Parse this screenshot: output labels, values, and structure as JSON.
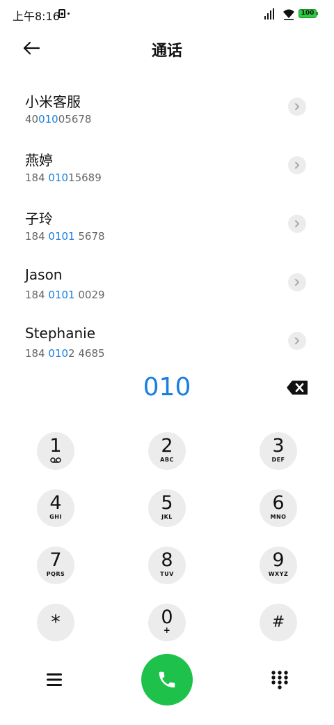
{
  "status_bar": {
    "time": "上午8:16",
    "battery": "100"
  },
  "header": {
    "title": "通话"
  },
  "contacts": [
    {
      "name": "小米客服",
      "number_prefix": "40",
      "number_match": "010",
      "number_suffix": "05678"
    },
    {
      "name": "燕婷",
      "number_prefix": "184 ",
      "number_match": "010",
      "number_suffix": "15689"
    },
    {
      "name": "子玲",
      "number_prefix": "184 ",
      "number_match": "0101",
      "number_suffix": " 5678"
    },
    {
      "name": "Jason",
      "number_prefix": "184 ",
      "number_match": "0101",
      "number_suffix": " 0029"
    },
    {
      "name": "Stephanie",
      "number_prefix": "184 ",
      "number_match": "010",
      "number_suffix": "2 4685"
    }
  ],
  "dialer": {
    "dialed": "010"
  },
  "keypad": {
    "keys": [
      {
        "digit": "1",
        "letters": ""
      },
      {
        "digit": "2",
        "letters": "ABC"
      },
      {
        "digit": "3",
        "letters": "DEF"
      },
      {
        "digit": "4",
        "letters": "GHI"
      },
      {
        "digit": "5",
        "letters": "JKL"
      },
      {
        "digit": "6",
        "letters": "MNO"
      },
      {
        "digit": "7",
        "letters": "PQRS"
      },
      {
        "digit": "8",
        "letters": "TUV"
      },
      {
        "digit": "9",
        "letters": "WXYZ"
      },
      {
        "digit": "*",
        "letters": ""
      },
      {
        "digit": "0",
        "letters": "+"
      },
      {
        "digit": "#",
        "letters": ""
      }
    ]
  },
  "colors": {
    "accent_blue": "#1a7fe0",
    "call_green": "#1ec24a",
    "battery_green": "#2ecc40",
    "key_gray": "#ececec"
  },
  "icons": {
    "back": "arrow-left-icon",
    "detail": "chevron-right-icon",
    "delete": "backspace-icon",
    "voicemail": "voicemail-icon",
    "menu": "hamburger-menu-icon",
    "call": "phone-icon",
    "dialpad": "dialpad-icon"
  }
}
